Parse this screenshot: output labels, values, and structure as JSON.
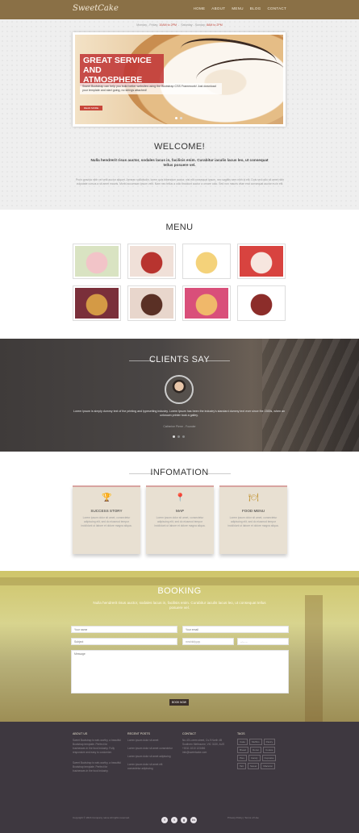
{
  "header": {
    "logo": "SweetCake",
    "nav": [
      "HOME",
      "ABOUT",
      "MENU",
      "BLOG",
      "CONTACT"
    ]
  },
  "hours": {
    "weekday_label": "Monday - Friday:",
    "weekday_time": "10AM to 2PM",
    "weekend_label": "Saturday - Sunday:",
    "weekend_time": "8AM to 2PM"
  },
  "hero": {
    "title": "GREAT SERVICE AND ATMOSPHERE",
    "text": "Sweet Bootstrap can help you build better websites using the Bootstrap CSS Framework! Just download your template and start going, no strings attached!",
    "button": "READ MORE"
  },
  "welcome": {
    "title": "WELCOME!",
    "subtitle": "Nulla hendrerit risus auctor, sodales lacus in, facilisis enim. Curabitur iaculis lacus leo, ut consequat tellus posuere vel.",
    "body": "Proin gravida nibh vel velit auctor aliquet. Aenean sollicitudin, lorem quis bibendum auctor, nisi elit consequat ipsum, nec sagittis sem nibh id elit. Duis sed odio sit amet nibh vulputate cursus a sit amet mauris. Morbi accumsan ipsum velit. Nam nec tellus a odio tincidunt auctor a ornare odio. Sed non mauris vitae erat consequat auctor eu in elit."
  },
  "menu": {
    "title": "MENU",
    "items": [
      {
        "name": "macarons",
        "c1": "#f2c4c8",
        "c2": "#d9e3c2"
      },
      {
        "name": "cupcakes",
        "c1": "#b8342f",
        "c2": "#f0e0d8"
      },
      {
        "name": "shortcake",
        "c1": "#f4d27a",
        "c2": "#ffffff"
      },
      {
        "name": "cheesecake",
        "c1": "#f7e6df",
        "c2": "#d8433f"
      },
      {
        "name": "pancakes",
        "c1": "#d49a45",
        "c2": "#7a2f3a"
      },
      {
        "name": "chocolate-cupcakes",
        "c1": "#5a3025",
        "c2": "#e8d6cc"
      },
      {
        "name": "ice-cream",
        "c1": "#f0b86a",
        "c2": "#d94f7a"
      },
      {
        "name": "whoopie-pies",
        "c1": "#8c2d2a",
        "c2": "#ffffff"
      }
    ]
  },
  "clients": {
    "title": "CLIENTS SAY",
    "quote": "Lorem Ipsum is simply dummy text of the printing and typesetting industry. Lorem Ipsum has been the industry's standard dummy text ever since the 1500s, when an unknown printer took a galley.",
    "author": "Catherine Pierre - Founder"
  },
  "information": {
    "title": "INFOMATION",
    "cards": [
      {
        "icon": "trophy-icon",
        "glyph": "🏆",
        "title": "SUCCESS STORY",
        "text": "Lorem ipsum dolor sit amet, consectetur adipiscing elit, sed do eiusmod tempor incididunt ut labore et dolore magna aliqua."
      },
      {
        "icon": "map-pin-icon",
        "glyph": "📍",
        "title": "MAP",
        "text": "Lorem ipsum dolor sit amet, consectetur adipiscing elit, sed do eiusmod tempor incididunt ut labore et dolore magna aliqua."
      },
      {
        "icon": "food-icon",
        "glyph": "🍽",
        "title": "FOOD MENU",
        "text": "Lorem ipsum dolor sit amet, consectetur adipiscing elit, sed do eiusmod tempor incididunt ut labore et dolore magna aliqua."
      }
    ]
  },
  "booking": {
    "title": "BOOKING",
    "subtitle": "Nulla hendrerit risus auctor, sodales lacus in, facilisis enim. Curabitur iaculis lacus leo, ut consequat tellus posuere vel.",
    "fields": {
      "name": "Your name",
      "email": "Your email",
      "subject": "Subject",
      "date": "mm/dd/yyyy",
      "time": "--:-- --",
      "message": "Message"
    },
    "button": "BOOK NOW"
  },
  "footer": {
    "about_title": "ABOUT US",
    "about_text": "Sweet Bootstrap is web-worthy, a beautiful Bootstrap template. Perfect for businesses in the food industry. Fully responsive and easy to customize.",
    "about_text2": "Sweet Bootstrap is web-worthy, a beautiful Bootstrap template. Perfect for businesses in the food industry.",
    "recent_title": "RECENT POSTS",
    "recent": [
      "Lorem ipsum dolor sit amet",
      "Lorem ipsum dolor sit amet consectetur",
      "Lorem ipsum dolor sit amet adipiscing",
      "Lorem ipsum dolor sit amet elit consectetur adipiscing"
    ],
    "contact_title": "CONTACT",
    "contact": [
      "No.43 Lorem street, Cs.9 North 4B",
      "Southern Melbourne, VIC 3130, AUS",
      "+0011 1010 123456",
      "info@sweetcake.com"
    ],
    "tags_title": "TAGS",
    "tags": [
      "Cake",
      "Muffins",
      "Pastry",
      "Bread",
      "Donut",
      "Cookie",
      "Pies",
      "Candy",
      "Cupcake",
      "Tart",
      "Sweet",
      "Macaron"
    ],
    "copyright": "Copyright © 2016 Company name All rights reserved.",
    "policy": "Privacy Policy  |  Terms of Use",
    "social": [
      "f",
      "t",
      "g",
      "in"
    ]
  }
}
